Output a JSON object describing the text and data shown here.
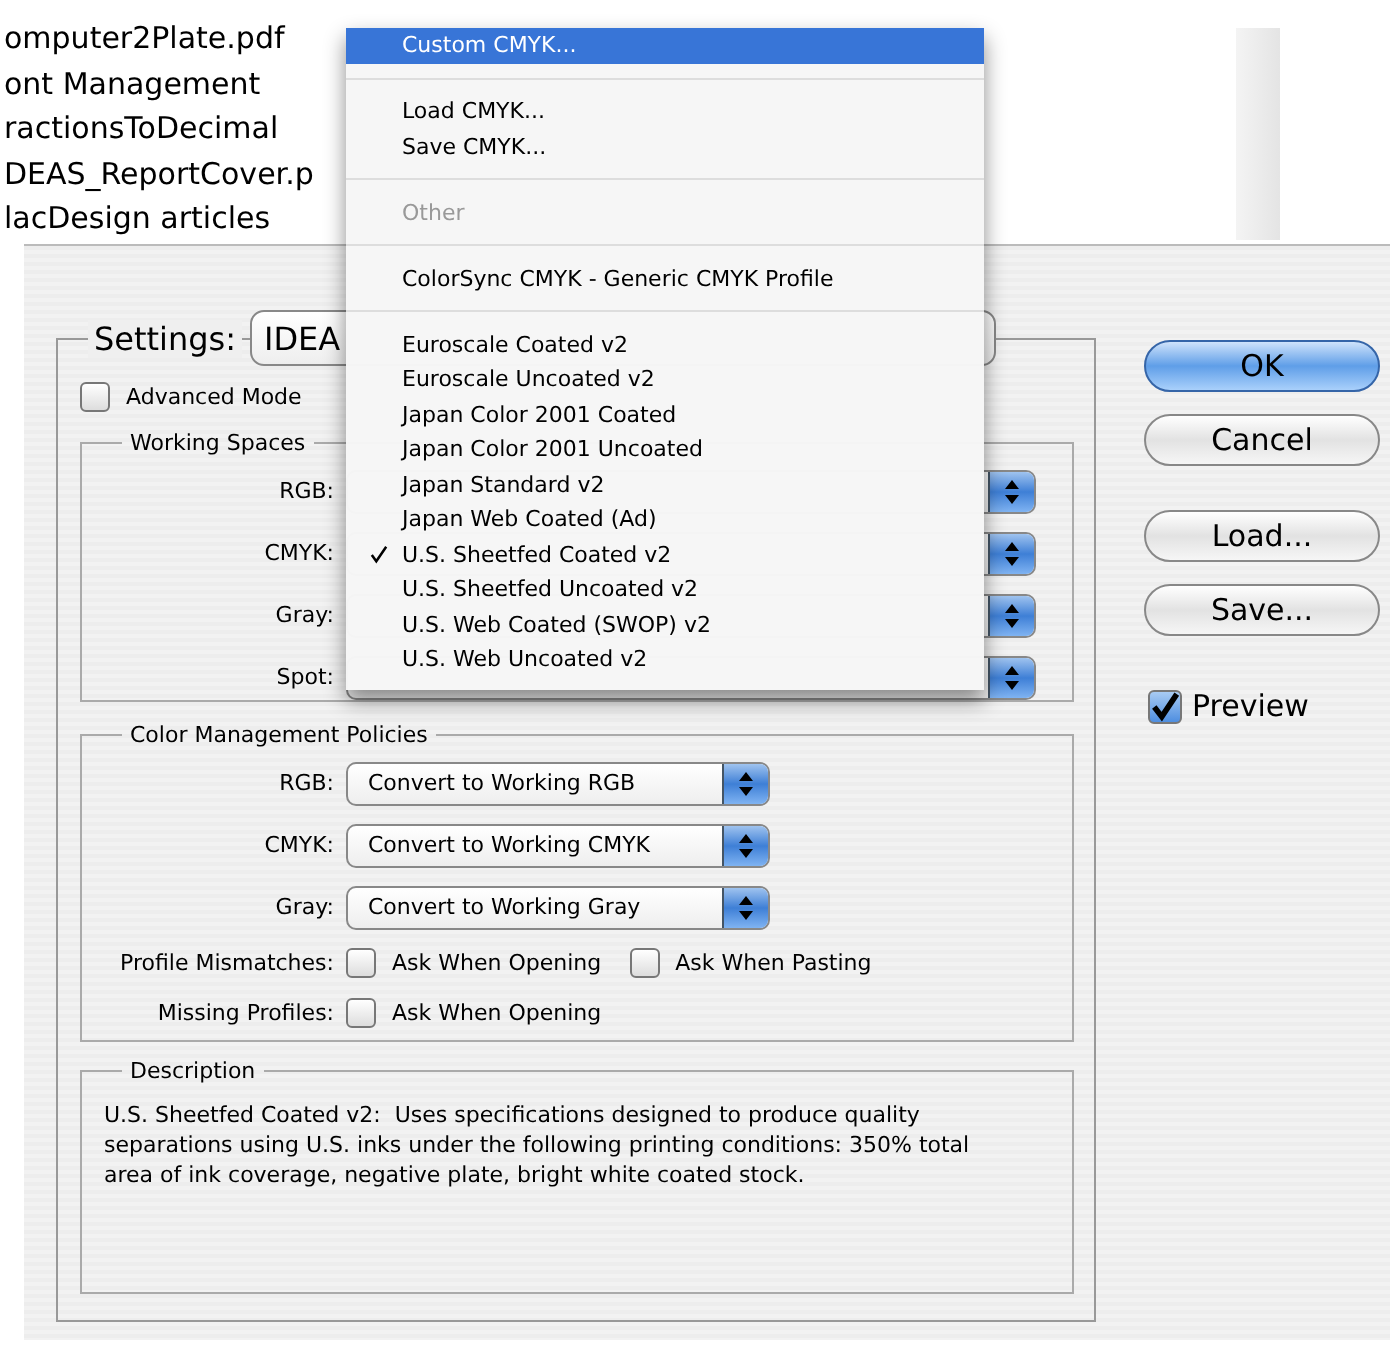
{
  "file_list": {
    "items": [
      "omputer2Plate.pdf",
      "ont Management",
      "ractionsToDecimal",
      "DEAS_ReportCover.p",
      "lacDesign articles"
    ]
  },
  "dialog": {
    "settings": {
      "label": "Settings:",
      "value": "IDEA"
    },
    "advanced_mode": {
      "label": "Advanced Mode",
      "checked": false
    },
    "working_spaces": {
      "title": "Working Spaces",
      "rows": [
        {
          "label": "RGB:"
        },
        {
          "label": "CMYK:"
        },
        {
          "label": "Gray:"
        },
        {
          "label": "Spot:"
        }
      ]
    },
    "policies": {
      "title": "Color Management Policies",
      "rows": [
        {
          "label": "RGB:",
          "value": "Convert to Working RGB"
        },
        {
          "label": "CMYK:",
          "value": "Convert to Working CMYK"
        },
        {
          "label": "Gray:",
          "value": "Convert to Working Gray"
        }
      ],
      "checks": [
        {
          "label": "Profile Mismatches:",
          "options": [
            {
              "label": "Ask When Opening",
              "checked": false
            },
            {
              "label": "Ask When Pasting",
              "checked": false
            }
          ]
        },
        {
          "label": "Missing Profiles:",
          "options": [
            {
              "label": "Ask When Opening",
              "checked": false
            }
          ]
        }
      ]
    },
    "description": {
      "title": "Description",
      "text": "U.S. Sheetfed Coated v2:  Uses specifications designed to produce quality separations using U.S. inks under the following printing conditions: 350% total area of ink coverage, negative plate, bright white coated stock."
    },
    "buttons": [
      {
        "label": "OK",
        "default": true
      },
      {
        "label": "Cancel",
        "default": false
      },
      {
        "label": "Load...",
        "default": false
      },
      {
        "label": "Save...",
        "default": false
      }
    ],
    "preview": {
      "label": "Preview",
      "checked": true
    }
  },
  "menu": {
    "sections": [
      [
        {
          "label": "Custom CMYK...",
          "highlighted": true,
          "checked": false,
          "disabled": false
        }
      ],
      [
        {
          "label": "Load CMYK...",
          "highlighted": false,
          "checked": false,
          "disabled": false
        },
        {
          "label": "Save CMYK...",
          "highlighted": false,
          "checked": false,
          "disabled": false
        }
      ],
      [
        {
          "label": "Other",
          "highlighted": false,
          "checked": false,
          "disabled": true
        }
      ],
      [
        {
          "label": "ColorSync CMYK - Generic CMYK Profile",
          "highlighted": false,
          "checked": false,
          "disabled": false
        }
      ],
      [
        {
          "label": "Euroscale Coated v2",
          "highlighted": false,
          "checked": false,
          "disabled": false
        },
        {
          "label": "Euroscale Uncoated v2",
          "highlighted": false,
          "checked": false,
          "disabled": false
        },
        {
          "label": "Japan Color 2001 Coated",
          "highlighted": false,
          "checked": false,
          "disabled": false
        },
        {
          "label": "Japan Color 2001 Uncoated",
          "highlighted": false,
          "checked": false,
          "disabled": false
        },
        {
          "label": "Japan Standard v2",
          "highlighted": false,
          "checked": false,
          "disabled": false
        },
        {
          "label": "Japan Web Coated (Ad)",
          "highlighted": false,
          "checked": false,
          "disabled": false
        },
        {
          "label": "U.S. Sheetfed Coated v2",
          "highlighted": false,
          "checked": true,
          "disabled": false
        },
        {
          "label": "U.S. Sheetfed Uncoated v2",
          "highlighted": false,
          "checked": false,
          "disabled": false
        },
        {
          "label": "U.S. Web Coated (SWOP) v2",
          "highlighted": false,
          "checked": false,
          "disabled": false
        },
        {
          "label": "U.S. Web Uncoated v2",
          "highlighted": false,
          "checked": false,
          "disabled": false
        }
      ]
    ]
  }
}
